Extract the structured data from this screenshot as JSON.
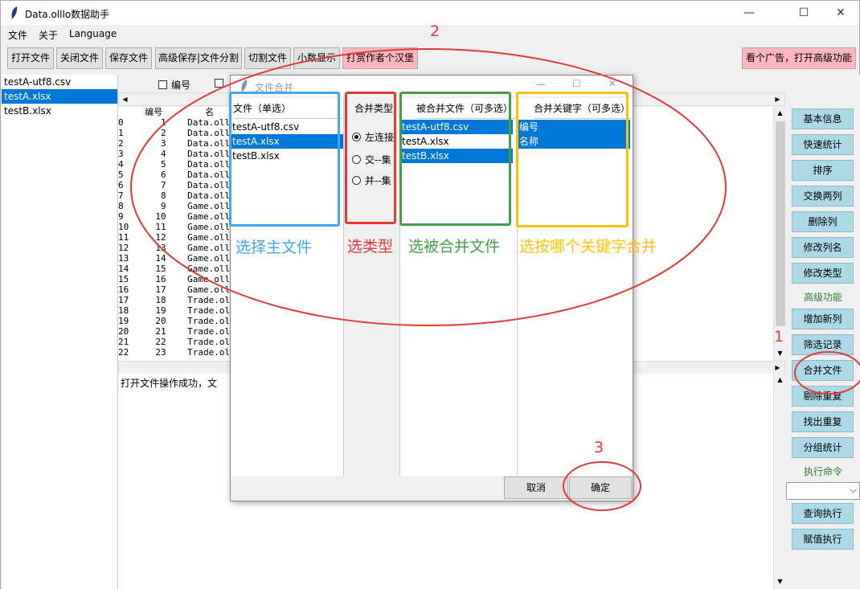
{
  "window": {
    "title": "Data.olllo数据助手",
    "min": "—",
    "max": "☐",
    "close": "✕"
  },
  "menu": [
    "文件",
    "关于",
    "Language"
  ],
  "toolbar": {
    "buttons": [
      "打开文件",
      "关闭文件",
      "保存文件",
      "高级保存|文件分割",
      "切割文件",
      "小数显示",
      "打赏作者个汉堡"
    ],
    "ad_button": "看个广告，打开高级功能"
  },
  "file_list": [
    "testA-utf8.csv",
    "testA.xlsx",
    "testB.xlsx"
  ],
  "main": {
    "checkbox_label": "编号",
    "columns": [
      "编号",
      "名"
    ],
    "rows": [
      [
        "0",
        "1",
        "Data.oll"
      ],
      [
        "1",
        "2",
        "Data.oll"
      ],
      [
        "2",
        "3",
        "Data.oll"
      ],
      [
        "3",
        "4",
        "Data.oll"
      ],
      [
        "4",
        "5",
        "Data.oll"
      ],
      [
        "5",
        "6",
        "Data.oll"
      ],
      [
        "6",
        "7",
        "Data.oll"
      ],
      [
        "7",
        "8",
        "Data.oll"
      ],
      [
        "8",
        "9",
        "Game.oll"
      ],
      [
        "9",
        "10",
        "Game.oll"
      ],
      [
        "10",
        "11",
        "Game.oll"
      ],
      [
        "11",
        "12",
        "Game.oll"
      ],
      [
        "12",
        "13",
        "Game.oll"
      ],
      [
        "13",
        "14",
        "Game.oll"
      ],
      [
        "14",
        "15",
        "Game.oll"
      ],
      [
        "15",
        "16",
        "Game.oll"
      ],
      [
        "16",
        "17",
        "Game.oll"
      ],
      [
        "17",
        "18",
        "Trade.oll"
      ],
      [
        "18",
        "19",
        "Trade.oll"
      ],
      [
        "19",
        "20",
        "Trade.oll"
      ],
      [
        "20",
        "21",
        "Trade.oll"
      ],
      [
        "21",
        "22",
        "Trade.oll"
      ],
      [
        "22",
        "23",
        "Trade.oll"
      ]
    ],
    "log": "打开文件操作成功，文"
  },
  "right_panel": {
    "buttons_top": [
      "基本信息",
      "快速统计",
      "排序",
      "交换两列",
      "删除列",
      "修改列名",
      "修改类型"
    ],
    "advanced_label": "高级功能",
    "buttons_adv": [
      "增加新列",
      "筛选记录",
      "合并文件",
      "剔除重复",
      "找出重复",
      "分组统计"
    ],
    "exec_label": "执行命令",
    "buttons_exec": [
      "查询执行",
      "赋值执行"
    ]
  },
  "dialog": {
    "title": "文件合并",
    "col1_header": "文件（单选）",
    "col1_items": [
      "testA-utf8.csv",
      "testA.xlsx",
      "testB.xlsx"
    ],
    "col2_header": "合并类型",
    "col2_radios": [
      "左连接",
      "交--集",
      "并--集"
    ],
    "col3_header": "被合并文件（可多选）",
    "col3_items": [
      "testA-utf8.csv",
      "testA.xlsx",
      "testB.xlsx"
    ],
    "col4_header": "合并关键字（可多选）",
    "col4_items": [
      "编号",
      "名称"
    ],
    "cancel": "取消",
    "ok": "确定"
  },
  "annotations": {
    "num1": "1",
    "num2": "2",
    "num3": "3",
    "label_main_file": "选择主文件",
    "label_type": "选类型",
    "label_merged": "选被合并文件",
    "label_key": "选按哪个关键字合并",
    "color_red": "#e53935",
    "color_blue": "#42a5f5",
    "color_green": "#43a047",
    "color_orange": "#ffc107"
  }
}
